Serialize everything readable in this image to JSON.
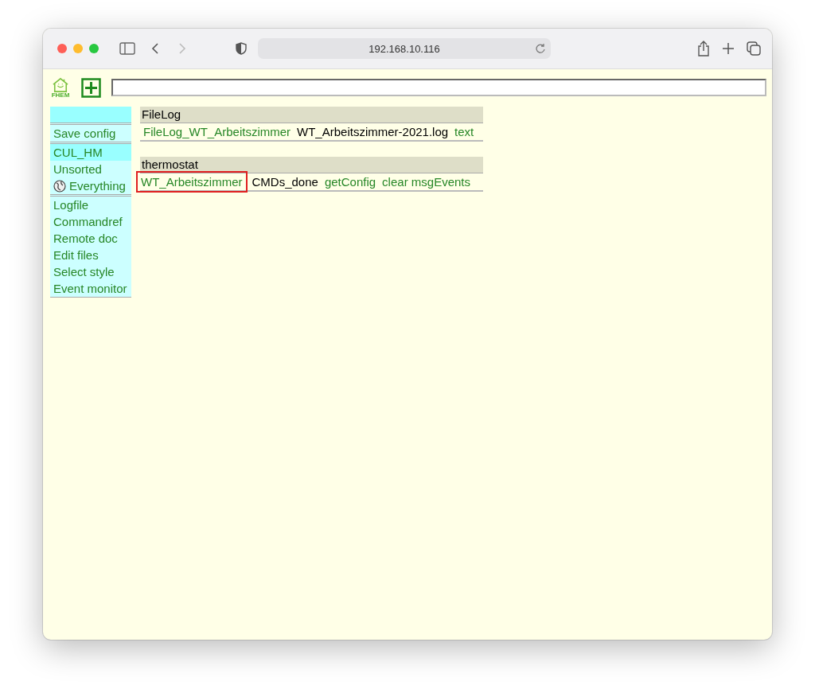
{
  "browser": {
    "url": "192.168.10.116"
  },
  "header": {
    "logo_text": "FHEM"
  },
  "sidebar": {
    "groups": [
      {
        "items": [
          {
            "label": "Save config",
            "selected": false,
            "kind": "link"
          }
        ]
      },
      {
        "items": [
          {
            "label": "CUL_HM",
            "selected": true,
            "kind": "link"
          },
          {
            "label": "Unsorted",
            "selected": false,
            "kind": "link"
          },
          {
            "label": "Everything",
            "selected": false,
            "kind": "globe"
          }
        ]
      },
      {
        "items": [
          {
            "label": "Logfile",
            "selected": false,
            "kind": "link"
          },
          {
            "label": "Commandref",
            "selected": false,
            "kind": "link"
          },
          {
            "label": "Remote doc",
            "selected": false,
            "kind": "link"
          },
          {
            "label": "Edit files",
            "selected": false,
            "kind": "link"
          },
          {
            "label": "Select style",
            "selected": false,
            "kind": "link"
          },
          {
            "label": "Event monitor",
            "selected": false,
            "kind": "link"
          }
        ]
      }
    ]
  },
  "tables": [
    {
      "title": "FileLog",
      "rows": [
        {
          "cells": [
            {
              "text": "FileLog_WT_Arbeitszimmer",
              "kind": "link",
              "highlighted": false
            },
            {
              "text": "WT_Arbeitszimmer-2021.log",
              "kind": "text",
              "highlighted": false
            },
            {
              "text": "text",
              "kind": "link",
              "highlighted": false
            }
          ]
        }
      ]
    },
    {
      "title": "thermostat",
      "rows": [
        {
          "cells": [
            {
              "text": "WT_Arbeitszimmer",
              "kind": "link",
              "highlighted": true
            },
            {
              "text": "CMDs_done",
              "kind": "text",
              "highlighted": false
            },
            {
              "text": "getConfig",
              "kind": "link",
              "highlighted": false
            },
            {
              "text": "clear msgEvents",
              "kind": "link",
              "highlighted": false
            }
          ]
        }
      ]
    }
  ]
}
